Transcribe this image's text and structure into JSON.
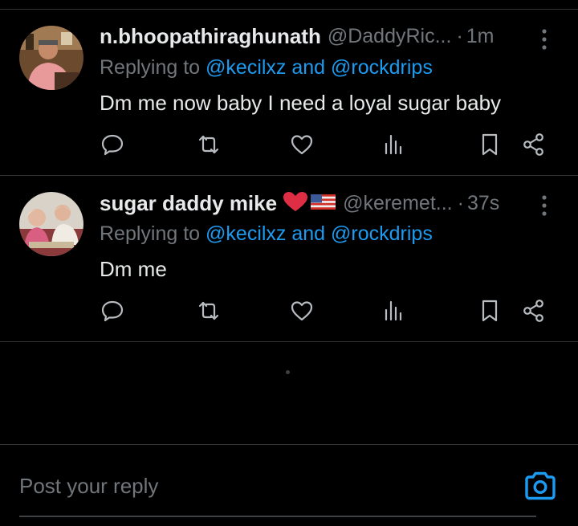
{
  "tweets": [
    {
      "name": "n.bhoopathiraghunath",
      "handle": "@DaddyRic...",
      "dot": "·",
      "time": "1m",
      "reply_prefix": "Replying to ",
      "reply_mentions": "@kecilxz and @rockdrips",
      "text": "Dm me now baby I need a loyal sugar baby",
      "emoji": []
    },
    {
      "name": "sugar daddy mike",
      "handle": "@keremet...",
      "dot": "·",
      "time": "37s",
      "reply_prefix": "Replying to ",
      "reply_mentions": "@kecilxz and @rockdrips",
      "text": "Dm me",
      "emoji": [
        "red-heart",
        "us-flag"
      ]
    }
  ],
  "composer": {
    "placeholder": "Post your reply"
  },
  "colors": {
    "background": "#000000",
    "text": "#e7e9ea",
    "muted": "#71767b",
    "accent": "#1d9bf0",
    "divider": "#2f3336"
  },
  "icons": [
    "more-vertical-icon",
    "reply-icon",
    "retweet-icon",
    "like-icon",
    "views-icon",
    "bookmark-icon",
    "share-icon",
    "camera-icon"
  ]
}
